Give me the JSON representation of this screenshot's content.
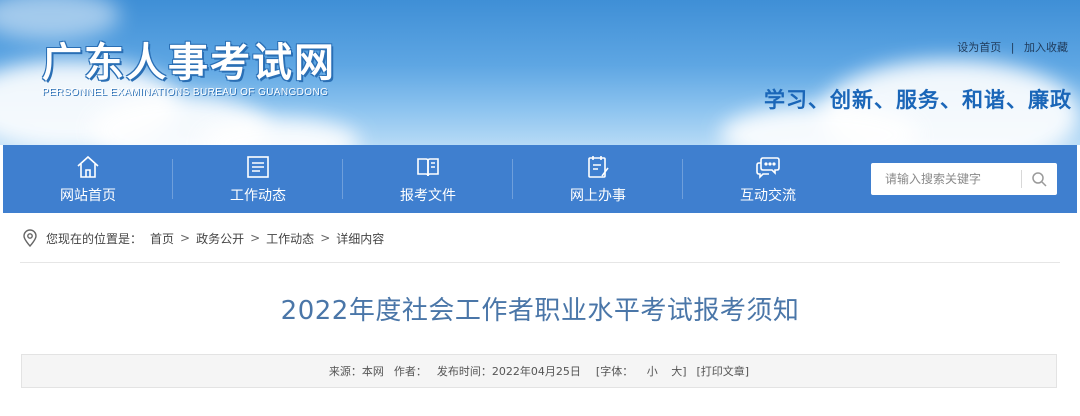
{
  "header": {
    "site_title": "广东人事考试网",
    "site_subtitle": "PERSONNEL EXAMINATIONS BUREAU OF GUANGDONG",
    "set_homepage": "设为首页",
    "link_separator": "|",
    "add_favorite": "加入收藏",
    "slogan": "学习、创新、服务、和谐、廉政"
  },
  "nav": {
    "items": [
      {
        "label": "网站首页",
        "icon": "home-icon"
      },
      {
        "label": "工作动态",
        "icon": "news-icon"
      },
      {
        "label": "报考文件",
        "icon": "book-icon"
      },
      {
        "label": "网上办事",
        "icon": "checklist-icon"
      },
      {
        "label": "互动交流",
        "icon": "chat-icon"
      }
    ],
    "search_placeholder": "请输入搜索关键字"
  },
  "breadcrumb": {
    "prefix": "您现在的位置是：",
    "items": [
      "首页",
      "政务公开",
      "工作动态",
      "详细内容"
    ],
    "separator": ">"
  },
  "article": {
    "title": "2022年度社会工作者职业水平考试报考须知",
    "meta": {
      "source_label": "来源：本网",
      "author_label": "作者：",
      "published_label": "发布时间：2022年04月25日",
      "font_label": "[字体：",
      "font_small": "小",
      "font_large": "大]",
      "print_label": "[打印文章]"
    }
  },
  "colors": {
    "nav_bg": "#3f7fcf",
    "slogan": "#1a66b8",
    "title": "#4a76a8"
  }
}
